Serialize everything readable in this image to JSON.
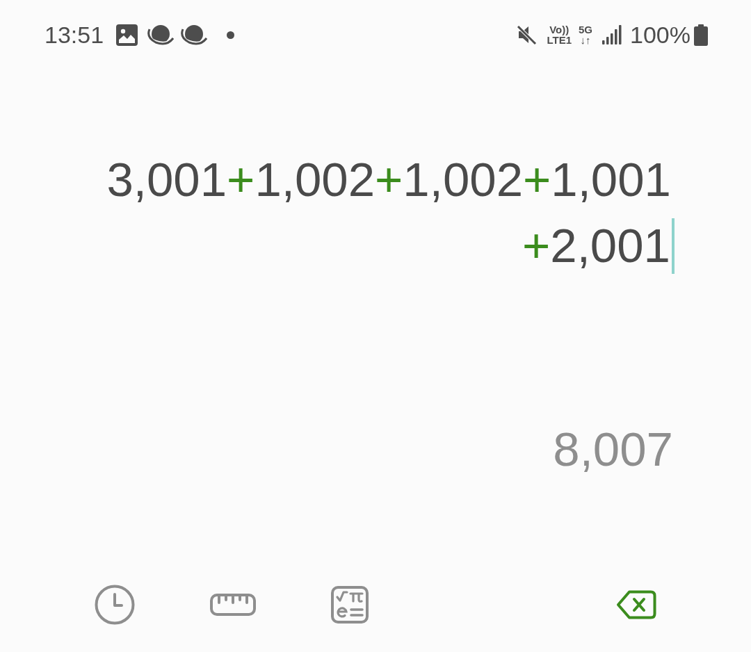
{
  "status_bar": {
    "time": "13:51",
    "volte": "Vo))",
    "lte": "LTE1",
    "network": "5G",
    "network_arrows": "↓↑",
    "battery": "100%"
  },
  "expression": {
    "lines": [
      [
        {
          "kind": "number",
          "text": "3,001"
        },
        {
          "kind": "operator",
          "text": "+"
        },
        {
          "kind": "number",
          "text": "1,002"
        },
        {
          "kind": "operator",
          "text": "+"
        },
        {
          "kind": "number",
          "text": "1,002"
        },
        {
          "kind": "operator",
          "text": "+"
        },
        {
          "kind": "number",
          "text": "1,001"
        }
      ],
      [
        {
          "kind": "operator",
          "text": "+"
        },
        {
          "kind": "number",
          "text": "2,001"
        }
      ]
    ],
    "cursor": true
  },
  "result": "8,007"
}
